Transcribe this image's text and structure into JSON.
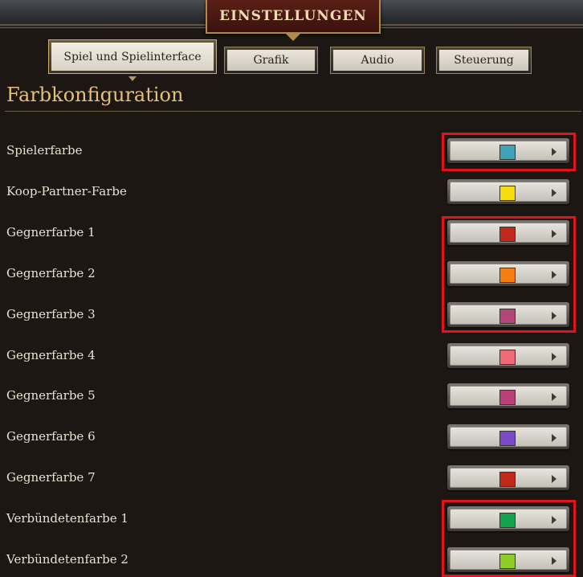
{
  "header": {
    "title": "Einstellungen"
  },
  "tabs": [
    {
      "label": "Spiel und Spielinterface",
      "active": true
    },
    {
      "label": "Grafik",
      "active": false
    },
    {
      "label": "Audio",
      "active": false
    },
    {
      "label": "Steuerung",
      "active": false
    }
  ],
  "section": {
    "title": "Farbkonfiguration"
  },
  "rows": [
    {
      "label": "Spielerfarbe",
      "color": "#3fa3b9"
    },
    {
      "label": "Koop-Partner-Farbe",
      "color": "#f5dc10"
    },
    {
      "label": "Gegnerfarbe 1",
      "color": "#c0281b"
    },
    {
      "label": "Gegnerfarbe 2",
      "color": "#f57d12"
    },
    {
      "label": "Gegnerfarbe 3",
      "color": "#b14677"
    },
    {
      "label": "Gegnerfarbe 4",
      "color": "#ee6a77"
    },
    {
      "label": "Gegnerfarbe 5",
      "color": "#b84179"
    },
    {
      "label": "Gegnerfarbe 6",
      "color": "#7a4ac9"
    },
    {
      "label": "Gegnerfarbe 7",
      "color": "#c0281b"
    },
    {
      "label": "Verbündetenfarbe 1",
      "color": "#13a34e"
    },
    {
      "label": "Verbündetenfarbe 2",
      "color": "#8ccd2a"
    }
  ],
  "highlight_color": "#e0141a"
}
